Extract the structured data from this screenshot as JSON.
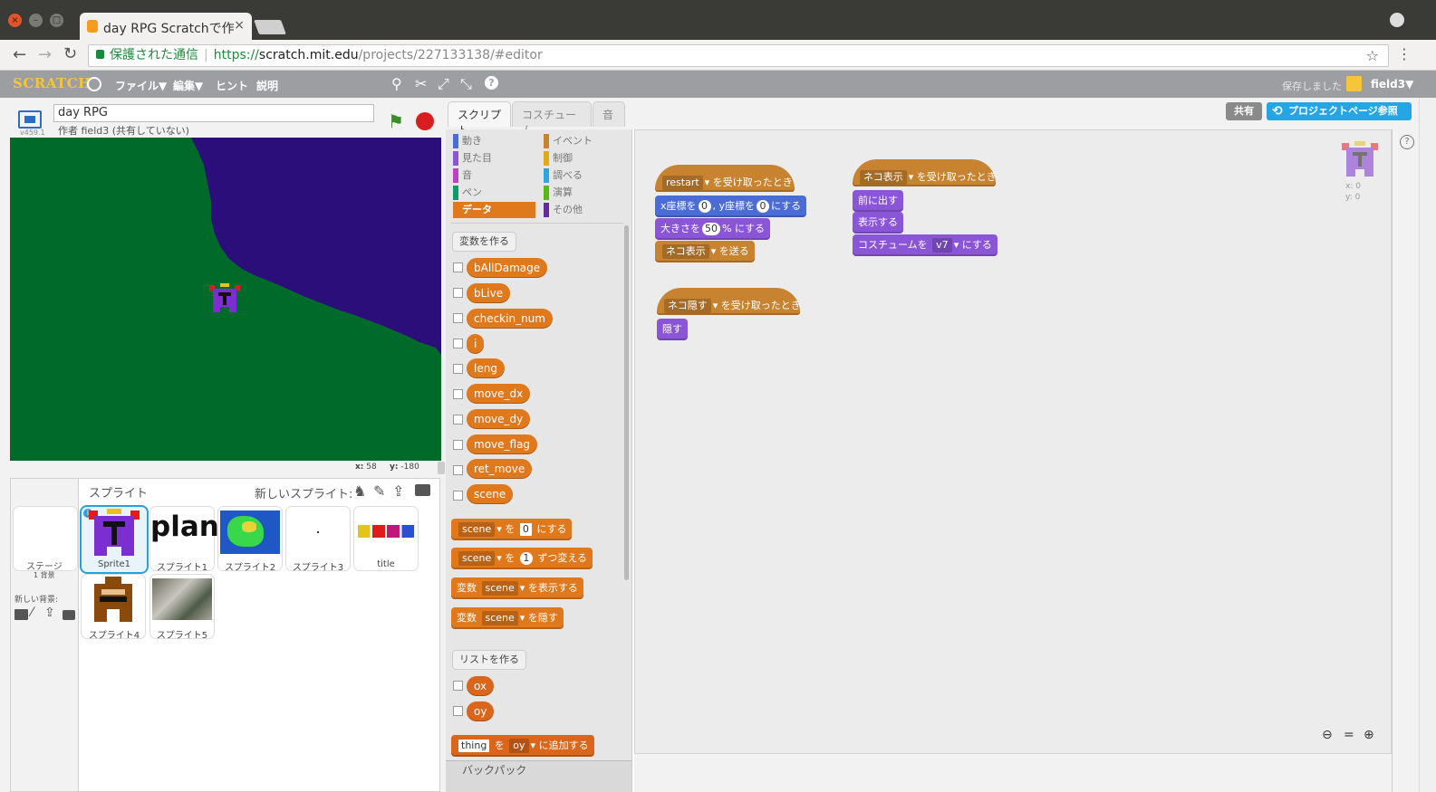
{
  "browser": {
    "tab_title": "day RPG Scratchで作",
    "url_secure_label": "保護された通信",
    "url_scheme": "https://",
    "url_host": "scratch.mit.edu",
    "url_path": "/projects/227133138/#editor"
  },
  "menubar": {
    "logo": "SCRATCH",
    "items": [
      "ファイル▼",
      "編集▼",
      "ヒント",
      "説明"
    ],
    "saved": "保存しました",
    "user": "field3▼"
  },
  "stage": {
    "project_title": "day RPG",
    "author": "作者 field3 (共有していない)",
    "version": "v459.1",
    "coords": {
      "x_label": "x:",
      "x": "58",
      "y_label": "y:",
      "y": "-180"
    }
  },
  "sprites": {
    "header": "スプライト",
    "new_sprite": "新しいスプライト:",
    "stage_label": "ステージ",
    "stage_sub": "1 背景",
    "new_backdrop": "新しい背景:",
    "items": [
      "Sprite1",
      "スプライト1",
      "スプライト2",
      "スプライト3",
      "title",
      "スプライト4",
      "スプライト5"
    ],
    "plan_text": "plan"
  },
  "editor_tabs": [
    "スクリプト",
    "コスチューム",
    "音"
  ],
  "share": {
    "share_label": "共有",
    "project_page": "プロジェクトページ参照"
  },
  "categories": {
    "left": [
      "動き",
      "見た目",
      "音",
      "ペン",
      "データ"
    ],
    "right": [
      "イベント",
      "制御",
      "調べる",
      "演算",
      "その他"
    ]
  },
  "palette": {
    "make_var": "変数を作る",
    "variables": [
      "bAllDamage",
      "bLive",
      "checkin_num",
      "i",
      "leng",
      "move_dx",
      "move_dy",
      "move_flag",
      "ret_move",
      "scene"
    ],
    "set_block": {
      "var": "scene",
      "a": "を",
      "val": "0",
      "b": "にする"
    },
    "change_block": {
      "var": "scene",
      "a": "を",
      "val": "1",
      "b": "ずつ変える"
    },
    "show_block": {
      "a": "変数",
      "var": "scene",
      "b": "を表示する"
    },
    "hide_block": {
      "a": "変数",
      "var": "scene",
      "b": "を隠す"
    },
    "make_list": "リストを作る",
    "lists": [
      "ox",
      "oy"
    ],
    "add_block": {
      "item": "thing",
      "a": "を",
      "list": "oy",
      "b": "に追加する"
    },
    "backpack": "バックパック"
  },
  "scripts": {
    "s1": {
      "hat_msg": "restart",
      "hat_text": "を受け取ったとき",
      "goto_a": "x座標を",
      "goto_x": "0",
      "goto_b": ", y座標を",
      "goto_y": "0",
      "goto_c": "にする",
      "size_a": "大きさを",
      "size_val": "50",
      "size_b": "% にする",
      "bcast_msg": "ネコ表示",
      "bcast_text": "を送る"
    },
    "s2": {
      "hat_msg": "ネコ表示",
      "hat_text": "を受け取ったとき",
      "front": "前に出す",
      "show": "表示する",
      "cos_a": "コスチュームを",
      "cos_val": "v7",
      "cos_b": "にする"
    },
    "s3": {
      "hat_msg": "ネコ隠す",
      "hat_text": "を受け取ったとき",
      "hide": "隠す"
    },
    "sprite_info": {
      "x": "x: 0",
      "y": "y: 0"
    }
  },
  "colors": {
    "data": "#e0781c",
    "events": "#c88330",
    "motion": "#4a6cd4",
    "looks": "#8a55d7",
    "stage_bg": "#006a2a",
    "stage_field": "#2b0e7a",
    "accent": "#25a5e4"
  }
}
